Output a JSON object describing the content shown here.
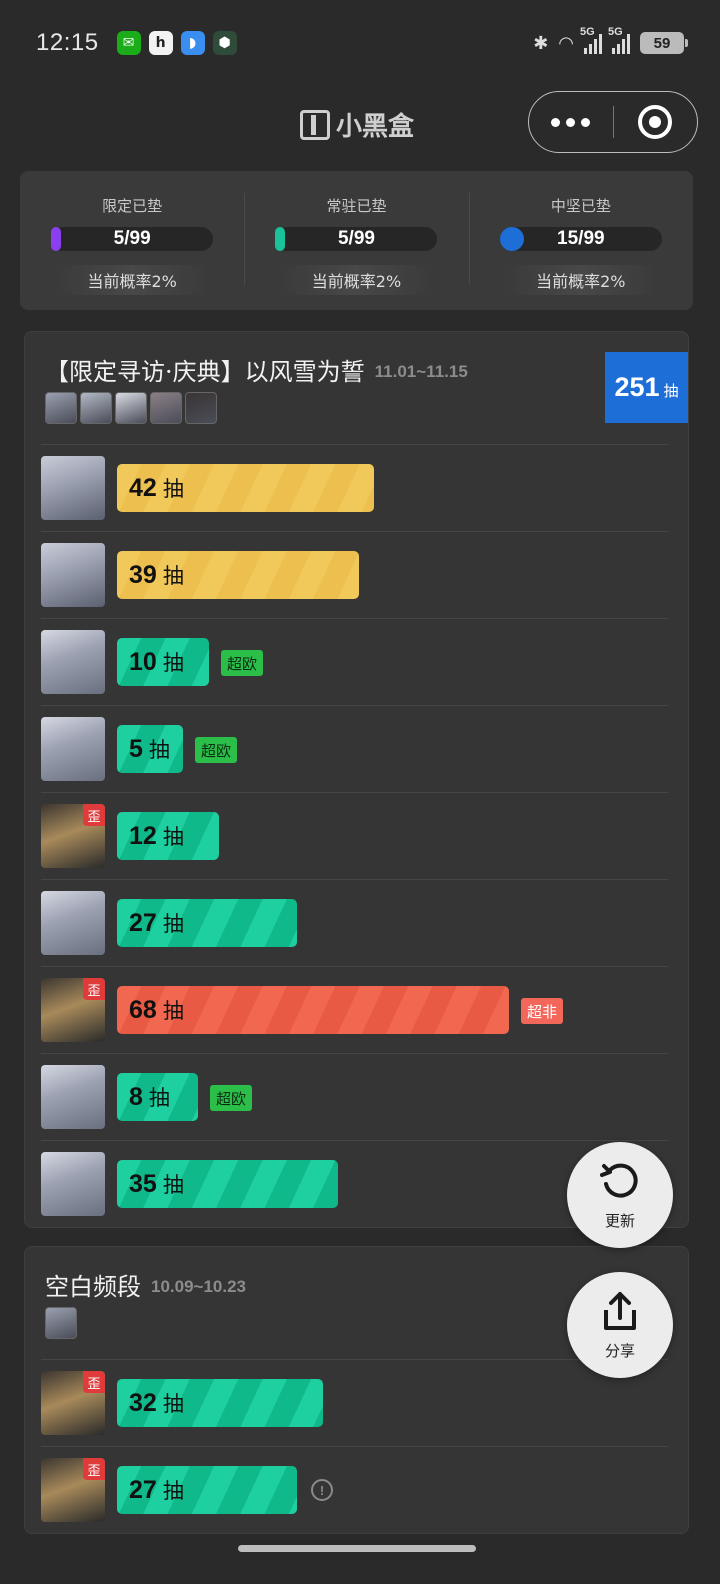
{
  "status_bar": {
    "time": "12:15",
    "network_1": "5G",
    "network_2": "5G",
    "battery": "59"
  },
  "nav": {
    "title": "小黑盒"
  },
  "pity": [
    {
      "label": "限定已垫",
      "value": "5/99",
      "fraction": 0.05,
      "color": "#8a3ff0",
      "rate": "当前概率2%"
    },
    {
      "label": "常驻已垫",
      "value": "5/99",
      "fraction": 0.05,
      "color": "#19c29a",
      "rate": "当前概率2%"
    },
    {
      "label": "中坚已垫",
      "value": "15/99",
      "fraction": 0.15,
      "color": "#1e6ed7",
      "rate": "当前概率2%"
    }
  ],
  "banners": [
    {
      "title": "【限定寻访·庆典】以风雪为誓",
      "date": "11.01~11.15",
      "total": "251",
      "total_unit": "抽",
      "pulls": [
        {
          "count": 42,
          "unit": "抽",
          "type": "gold",
          "tag": "",
          "off": ""
        },
        {
          "count": 39,
          "unit": "抽",
          "type": "gold",
          "tag": "",
          "off": ""
        },
        {
          "count": 10,
          "unit": "抽",
          "type": "green",
          "tag": "超欧",
          "off": ""
        },
        {
          "count": 5,
          "unit": "抽",
          "type": "green",
          "tag": "超欧",
          "off": ""
        },
        {
          "count": 12,
          "unit": "抽",
          "type": "green",
          "tag": "",
          "off": "歪"
        },
        {
          "count": 27,
          "unit": "抽",
          "type": "green",
          "tag": "",
          "off": ""
        },
        {
          "count": 68,
          "unit": "抽",
          "type": "red",
          "tag": "超非",
          "off": "歪"
        },
        {
          "count": 8,
          "unit": "抽",
          "type": "green",
          "tag": "超欧",
          "off": ""
        },
        {
          "count": 35,
          "unit": "抽",
          "type": "green",
          "tag": "",
          "off": ""
        }
      ]
    },
    {
      "title": "空白频段",
      "date": "10.09~10.23",
      "total": "",
      "total_unit": "",
      "pulls": [
        {
          "count": 32,
          "unit": "抽",
          "type": "green",
          "tag": "",
          "off": "歪"
        },
        {
          "count": 27,
          "unit": "抽",
          "type": "green",
          "tag": "",
          "off": "歪",
          "info": "!"
        }
      ]
    }
  ],
  "fab": {
    "refresh_label": "更新",
    "share_label": "分享"
  }
}
